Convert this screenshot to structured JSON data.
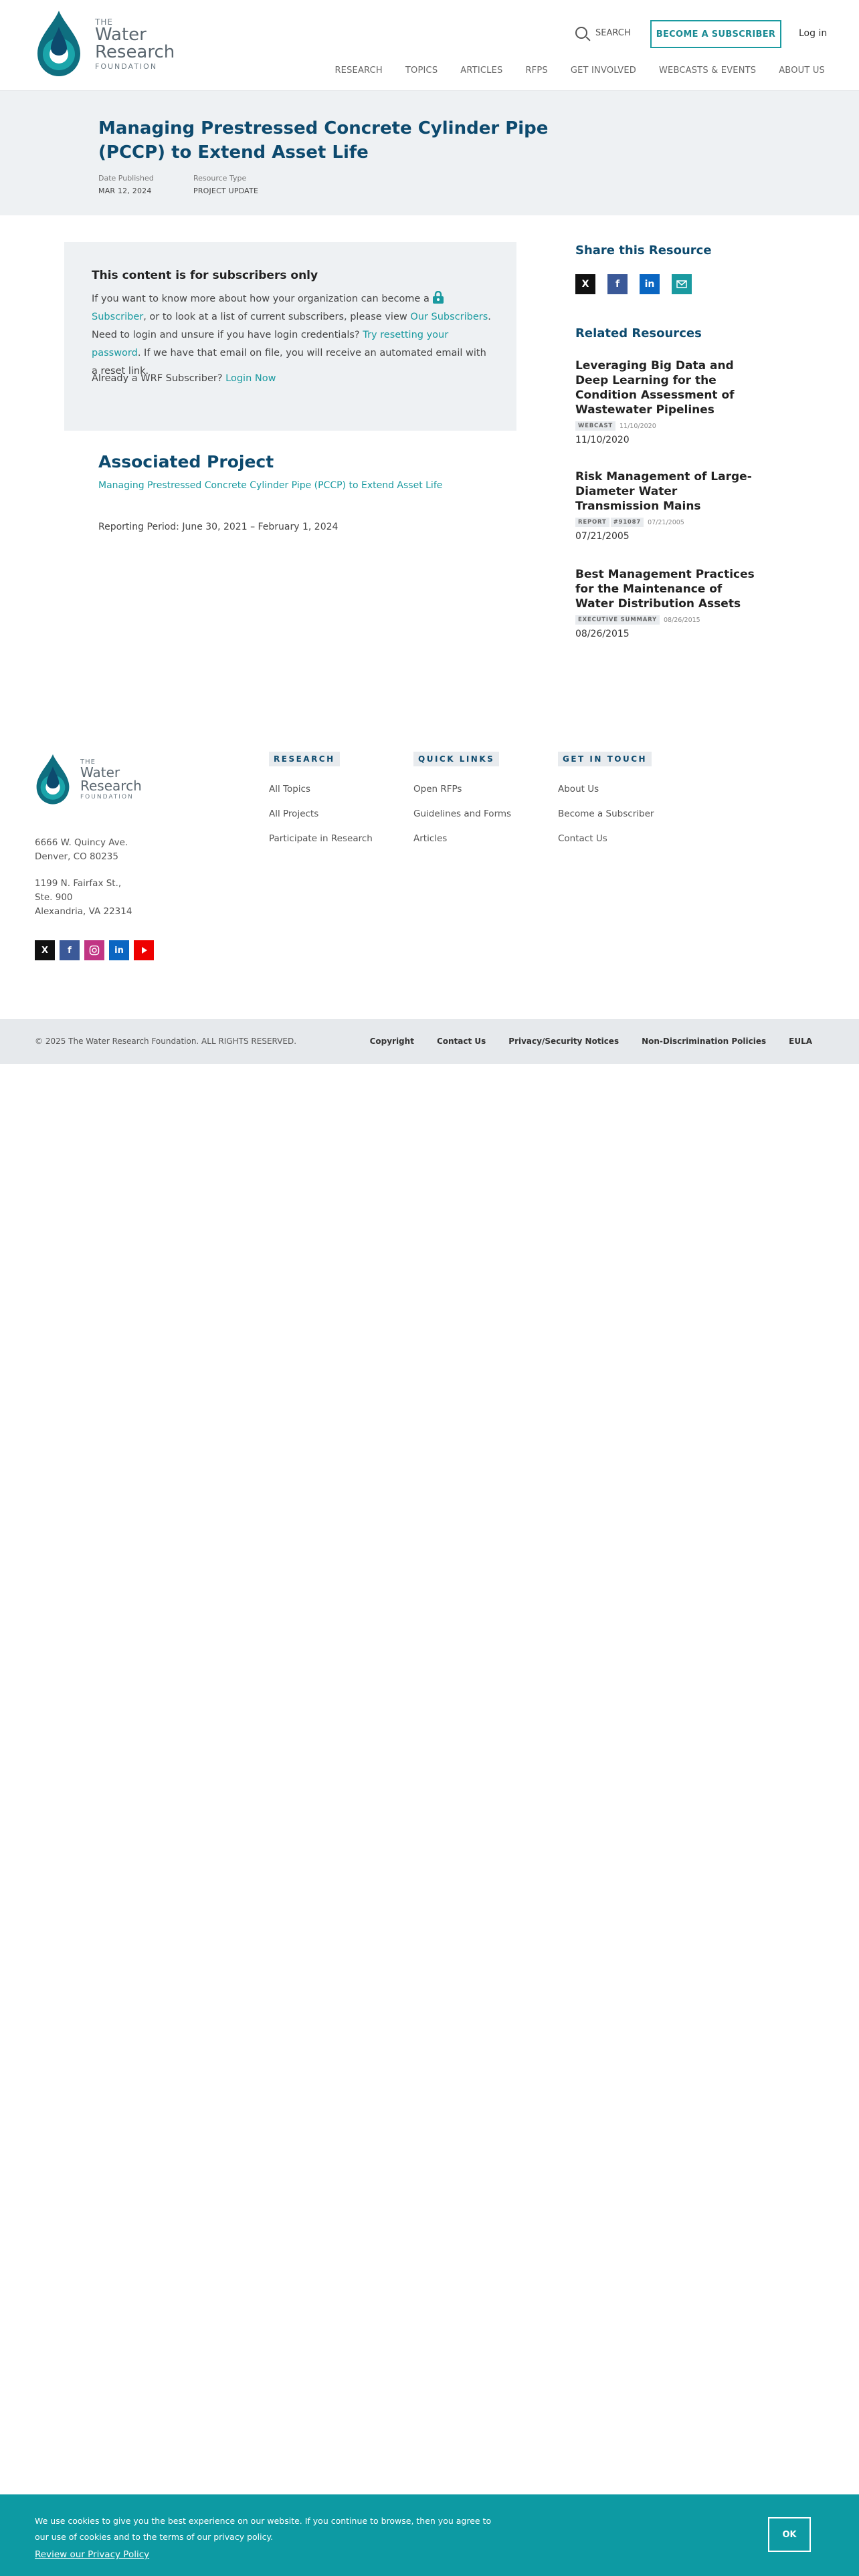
{
  "header": {
    "logo": {
      "the": "THE",
      "line1": "Water",
      "line2": "Research",
      "foundation": "FOUNDATION"
    },
    "search_label": "SEARCH",
    "subscribe_label": "BECOME A SUBSCRIBER",
    "login_label": "Log in",
    "nav": [
      "RESEARCH",
      "TOPICS",
      "ARTICLES",
      "RFPS",
      "GET INVOLVED",
      "WEBCASTS & EVENTS",
      "ABOUT US"
    ]
  },
  "page": {
    "title": "Managing Prestressed Concrete Cylinder Pipe (PCCP) to Extend Asset Life",
    "date_label": "Date Published",
    "date_value": "MAR 12, 2024",
    "type_label": "Resource Type",
    "type_value": "PROJECT UPDATE"
  },
  "subscriber_box": {
    "heading": "This content is for subscribers only",
    "p1": "If you want to know more about how your organization can become a ",
    "subscriber_link": "Subscriber",
    "p2": ", or to look at a list of current subscribers, please view ",
    "our_subscribers_link": "Our Subscribers",
    "p3": ". Need to login and unsure if you have login credentials? ",
    "reset_link": "Try resetting your password",
    "p4": ". If we have that email on file, you will receive an automated email with a reset link.",
    "already_text": "Already a WRF Subscriber? ",
    "login_now": "Login Now"
  },
  "associated": {
    "heading": "Associated Project",
    "link": "Managing Prestressed Concrete Cylinder Pipe (PCCP) to Extend Asset Life",
    "period": "Reporting Period: June 30, 2021 – February 1, 2024"
  },
  "sidebar": {
    "share_heading": "Share this Resource",
    "share_icons": [
      "x-icon",
      "facebook-icon",
      "linkedin-icon",
      "email-icon"
    ],
    "related_heading": "Related Resources",
    "related": [
      {
        "title": "Leveraging Big Data and Deep Learning for the Condition Assessment of Wastewater Pipelines",
        "tags": [
          "WEBCAST"
        ],
        "small_date": "11/10/2020",
        "date": "11/10/2020"
      },
      {
        "title": "Risk Management of Large-Diameter Water Transmission Mains",
        "tags": [
          "REPORT",
          "#91087"
        ],
        "small_date": "07/21/2005",
        "date": "07/21/2005"
      },
      {
        "title": "Best Management Practices for the Maintenance of Water Distribution Assets",
        "tags": [
          "EXECUTIVE SUMMARY"
        ],
        "small_date": "08/26/2015",
        "date": "08/26/2015"
      }
    ]
  },
  "footer": {
    "address1": [
      "6666 W. Quincy Ave.",
      "Denver, CO 80235"
    ],
    "address2": [
      "1199 N. Fairfax St.,",
      "Ste. 900",
      "Alexandria, VA 22314"
    ],
    "columns": [
      {
        "heading": "RESEARCH",
        "links": [
          "All Topics",
          "All Projects",
          "Participate in Research"
        ]
      },
      {
        "heading": "QUICK LINKS",
        "links": [
          "Open RFPs",
          "Guidelines and Forms",
          "Articles"
        ]
      },
      {
        "heading": "GET IN TOUCH",
        "links": [
          "About Us",
          "Become a Subscriber",
          "Contact Us"
        ]
      }
    ],
    "copyright": "© 2025 The Water Research Foundation.  ALL RIGHTS RESERVED.",
    "bottom_links": [
      "Copyright",
      "Contact Us",
      "Privacy/Security Notices",
      "Non-Discrimination Policies",
      "EULA"
    ]
  },
  "cookie": {
    "message": "We use cookies to give you the best experience on our website. If you continue to browse, then you agree to our use of cookies and to the terms of our privacy policy.",
    "privacy_link": "Review our Privacy Policy",
    "ok_label": "OK"
  },
  "colors": {
    "brand_dark": "#0d4a6e",
    "teal": "#1a9aa0",
    "cookie_bg": "#0d9aa3"
  }
}
